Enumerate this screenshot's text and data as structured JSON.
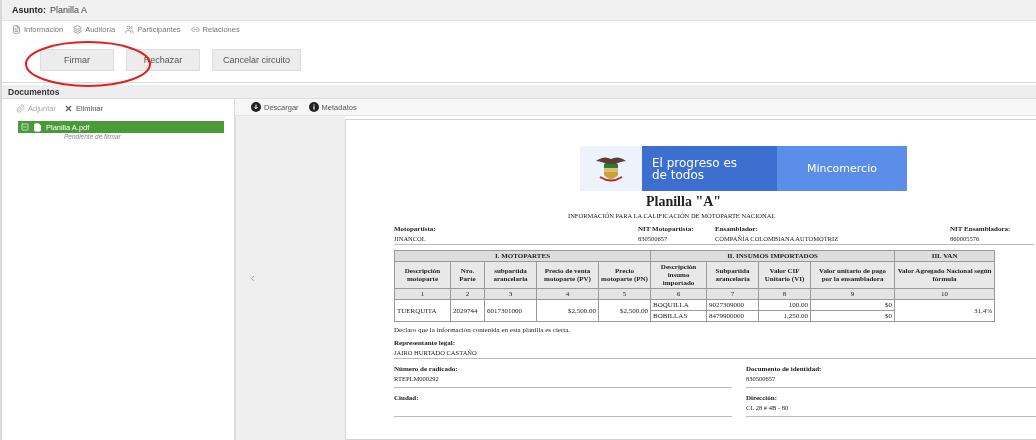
{
  "subject": {
    "label": "Asunto:",
    "value": "Planilla A"
  },
  "tabs": [
    {
      "label": "Información",
      "kind": "info"
    },
    {
      "label": "Auditoría",
      "kind": "audit"
    },
    {
      "label": "Participantes",
      "kind": "people"
    },
    {
      "label": "Relaciones",
      "kind": "link"
    }
  ],
  "actions": [
    {
      "label": "Firmar",
      "highlighted": true
    },
    {
      "label": "Rechazar",
      "highlighted": false
    },
    {
      "label": "Cancelar circuito",
      "highlighted": false
    }
  ],
  "documents": {
    "title": "Documentos",
    "tools": [
      {
        "label": "Adjuntar",
        "kind": "attach",
        "disabled": true
      },
      {
        "label": "Eliminar",
        "kind": "delete",
        "disabled": false
      }
    ],
    "files": [
      {
        "name": "Planilla A.pdf",
        "status": "Pendiente de firmar",
        "selected": true,
        "expanded": true
      }
    ]
  },
  "viewer": {
    "tools": [
      {
        "label": "Descargar",
        "kind": "download"
      },
      {
        "label": "Metadatos",
        "kind": "metadata"
      }
    ],
    "document": {
      "banner": {
        "slogan": "El progreso es de todos",
        "brand": "Mincomercio"
      },
      "title": "Planilla \"A\"",
      "subtitle": "INFORMACIÓN PARA LA CALIFICACIÓN DE MOTOPARTE NACIONAL",
      "parties": [
        {
          "label": "Motopartista:",
          "value": "JINANCOL"
        },
        {
          "label": "NIT Motopartista:",
          "value": "830500657"
        },
        {
          "label": "Ensamblador:",
          "value": "COMPAÑÍA COLOMBIANA AUTOMOTRIZ"
        },
        {
          "label": "NIT Ensambladora:",
          "value": "860005576"
        }
      ],
      "table": {
        "groups": [
          {
            "label": "I. MOTOPARTES",
            "columns": [
              {
                "label": "Descripción motoparte",
                "number": "1"
              },
              {
                "label": "Nro. Parte",
                "number": "2"
              },
              {
                "label": "subpartida arancelaria",
                "number": "3"
              },
              {
                "label": "Precio de venta motoparte (PV)",
                "number": "4"
              },
              {
                "label": "Precio motoparte (PN)",
                "number": "5"
              }
            ]
          },
          {
            "label": "II. INSUMOS IMPORTADOS",
            "columns": [
              {
                "label": "Descripción insumo importado",
                "number": "6"
              },
              {
                "label": "Subpartida arancelaria",
                "number": "7"
              },
              {
                "label": "Valor CIF Unitario (VI)",
                "number": "8"
              },
              {
                "label": "Valor unitario de pago por la ensambladora",
                "number": "9"
              }
            ]
          },
          {
            "label": "III. VAN",
            "columns": [
              {
                "label": "Valor Agregado Nacional según fórmula",
                "number": "10"
              }
            ]
          }
        ],
        "rows": [
          {
            "motoparte": [
              "TUERQUITA",
              "2029744",
              "6017301000",
              "$2,500.00",
              "$2,500.00"
            ],
            "insumos": [
              [
                "BOQUILLA",
                "9027309000",
                "100.00",
                "$0"
              ],
              [
                "BOBILLAS",
                "8479900000",
                "1,250.00",
                "$0"
              ]
            ],
            "van": "31.4%"
          }
        ]
      },
      "declaration": "Declaro que la información contenida en esta planilla es cierta.",
      "representative": {
        "label": "Representante legal:",
        "value": "JAIRO HURTADO CASTAÑO"
      },
      "fields": [
        {
          "label": "Número de radicado:",
          "value": "RTEPLM000292"
        },
        {
          "label": "Documento de identidad:",
          "value": "830500657"
        },
        {
          "label": "Ciudad:"
        },
        {
          "label": "Dirección:",
          "value": "CL 28 # 4B - 80"
        }
      ]
    }
  }
}
